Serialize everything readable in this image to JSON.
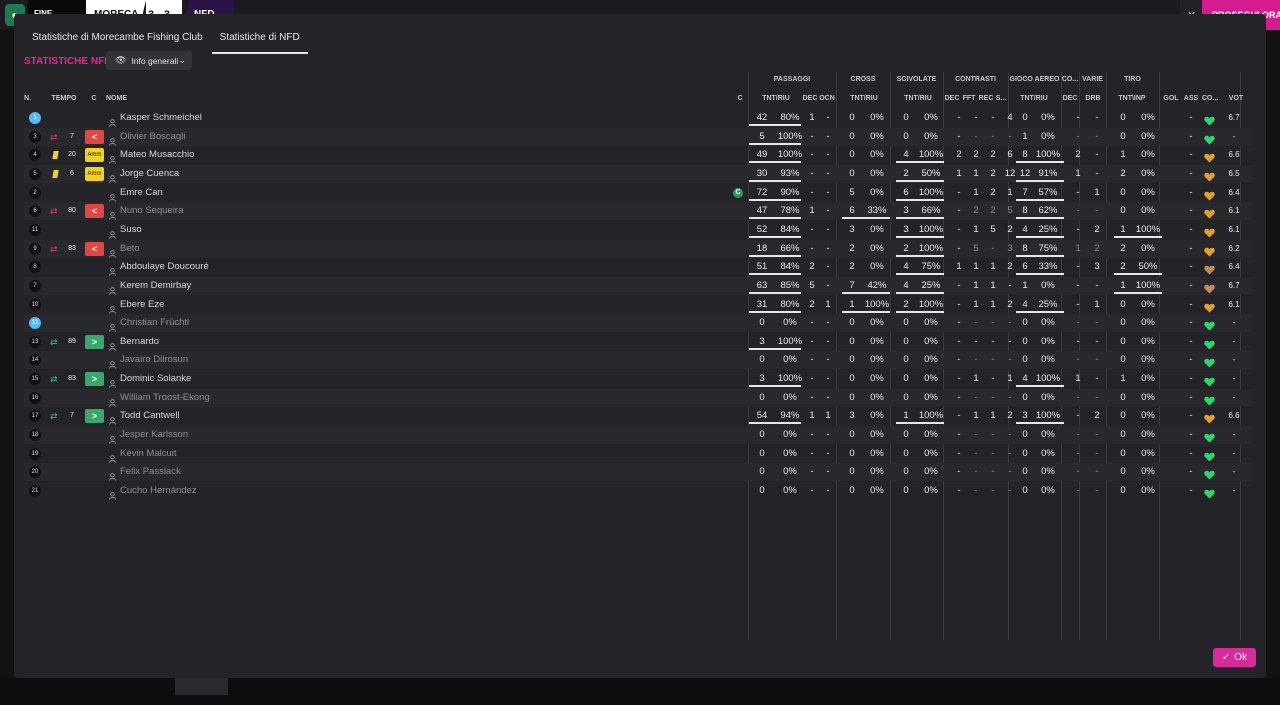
{
  "header": {
    "status": "FINE PARTITA",
    "team_home": "MORECA",
    "score": "3 - 3",
    "team_away": "NFD",
    "close_symbol": "✕",
    "continue_label": "PROSEGUI ORA"
  },
  "tabs": [
    {
      "label": "Statistiche di Morecambe Fishing Club",
      "active": false
    },
    {
      "label": "Statistiche di NFD",
      "active": true
    }
  ],
  "section_title": "STATISTICHE NFD",
  "view_select": {
    "value": "Info generali"
  },
  "groups": [
    "PASSAGGI",
    "CROSS",
    "SCIVOLATE",
    "CONTRASTI",
    "GIOCO AEREO",
    "CO...",
    "VARIE",
    "TIRO"
  ],
  "columns": {
    "n": "N.",
    "tempo": "TEMPO",
    "c": "C",
    "nome": "NOME",
    "c2": "C",
    "pass_tnt": "TNT/RIU",
    "pass_dec": "DEC",
    "pass_ocn": "OCN",
    "cross_tnt": "TNT/RIU",
    "sciv_tnt": "TNT/RIU",
    "con_dec": "DEC",
    "con_fft": "FFT",
    "con_rec": "REC",
    "con_s": "S...",
    "aereo_tnt": "TNT/RIU",
    "co_dec": "DEC",
    "varie_drb": "DRB",
    "tiro_tnt": "TNT\\INP",
    "gol": "GOL",
    "ass": "ASS",
    "co2": "CO...",
    "vot": "VOT"
  },
  "players": [
    {
      "num": "1",
      "gk": true,
      "tempo": "",
      "sub": "",
      "card": "",
      "badge": "",
      "name": "Kasper Schmeichel",
      "dim": false,
      "motm": false,
      "p1": "42",
      "p2": "80%",
      "dec": "1",
      "ocn": "-",
      "cr1": "0",
      "cr2": "0%",
      "sc1": "0",
      "sc2": "0%",
      "cdec": "-",
      "cfft": "-",
      "crec": "-",
      "cs": "4",
      "ga1": "0",
      "ga2": "0%",
      "codec": "-",
      "drb": "-",
      "t1": "0",
      "t2": "0%",
      "gol": "",
      "ass": "-",
      "heart": "green",
      "vot": "6.7",
      "ul_p": true,
      "ul_cr": false,
      "ul_sc": false,
      "ul_ga": false,
      "ul_t": false
    },
    {
      "num": "3",
      "gk": false,
      "tempo": "7",
      "sub": "out",
      "card": "",
      "badge": "red",
      "name": "Olivier Boscagli",
      "dim": true,
      "motm": false,
      "p1": "5",
      "p2": "100%",
      "dec": "-",
      "ocn": "-",
      "cr1": "0",
      "cr2": "0%",
      "sc1": "0",
      "sc2": "0%",
      "cdec": "-",
      "cfft": "-",
      "crec": "-",
      "cs": "-",
      "ga1": "1",
      "ga2": "0%",
      "codec": "-",
      "drb": "-",
      "t1": "0",
      "t2": "0%",
      "gol": "",
      "ass": "-",
      "heart": "green",
      "vot": "-",
      "ul_p": true,
      "ul_cr": false,
      "ul_sc": false,
      "ul_ga": false,
      "ul_t": false
    },
    {
      "num": "4",
      "gk": false,
      "tempo": "20",
      "sub": "",
      "card": "yellow",
      "badge": "amm",
      "name": "Mateo Musacchio",
      "dim": false,
      "motm": false,
      "p1": "49",
      "p2": "100%",
      "dec": "-",
      "ocn": "-",
      "cr1": "0",
      "cr2": "0%",
      "sc1": "4",
      "sc2": "100%",
      "cdec": "2",
      "cfft": "2",
      "crec": "2",
      "cs": "6",
      "ga1": "8",
      "ga2": "100%",
      "codec": "2",
      "drb": "-",
      "t1": "1",
      "t2": "0%",
      "gol": "",
      "ass": "-",
      "heart": "gold",
      "vot": "6.6",
      "ul_p": true,
      "ul_cr": false,
      "ul_sc": true,
      "ul_ga": true,
      "ul_t": false
    },
    {
      "num": "5",
      "gk": false,
      "tempo": "6",
      "sub": "",
      "card": "yellow",
      "badge": "amm",
      "name": "Jorge Cuenca",
      "dim": false,
      "motm": false,
      "p1": "30",
      "p2": "93%",
      "dec": "-",
      "ocn": "-",
      "cr1": "0",
      "cr2": "0%",
      "sc1": "2",
      "sc2": "50%",
      "cdec": "1",
      "cfft": "1",
      "crec": "2",
      "cs": "12",
      "ga1": "12",
      "ga2": "91%",
      "codec": "1",
      "drb": "-",
      "t1": "2",
      "t2": "0%",
      "gol": "",
      "ass": "-",
      "heart": "gold",
      "vot": "6.5",
      "ul_p": true,
      "ul_cr": false,
      "ul_sc": true,
      "ul_ga": true,
      "ul_t": false
    },
    {
      "num": "2",
      "gk": false,
      "tempo": "",
      "sub": "",
      "card": "",
      "badge": "",
      "name": "Emre Can",
      "dim": false,
      "motm": true,
      "p1": "72",
      "p2": "90%",
      "dec": "-",
      "ocn": "-",
      "cr1": "5",
      "cr2": "0%",
      "sc1": "6",
      "sc2": "100%",
      "cdec": "-",
      "cfft": "1",
      "crec": "2",
      "cs": "1",
      "ga1": "7",
      "ga2": "57%",
      "codec": "-",
      "drb": "1",
      "t1": "0",
      "t2": "0%",
      "gol": "",
      "ass": "-",
      "heart": "gold",
      "vot": "6.4",
      "ul_p": true,
      "ul_cr": false,
      "ul_sc": true,
      "ul_ga": true,
      "ul_t": false
    },
    {
      "num": "6",
      "gk": false,
      "tempo": "80",
      "sub": "out",
      "card": "",
      "badge": "red",
      "name": "Nuno Sequeira",
      "dim": true,
      "motm": false,
      "p1": "47",
      "p2": "78%",
      "dec": "1",
      "ocn": "-",
      "cr1": "6",
      "cr2": "33%",
      "sc1": "3",
      "sc2": "66%",
      "cdec": "-",
      "cfft": "2",
      "crec": "2",
      "cs": "5",
      "ga1": "8",
      "ga2": "62%",
      "codec": "-",
      "drb": "-",
      "t1": "0",
      "t2": "0%",
      "gol": "",
      "ass": "-",
      "heart": "gold",
      "vot": "6.1",
      "ul_p": true,
      "ul_cr": true,
      "ul_sc": true,
      "ul_ga": true,
      "ul_t": false
    },
    {
      "num": "11",
      "gk": false,
      "tempo": "",
      "sub": "",
      "card": "",
      "badge": "",
      "name": "Suso",
      "dim": false,
      "motm": false,
      "p1": "52",
      "p2": "84%",
      "dec": "-",
      "ocn": "-",
      "cr1": "3",
      "cr2": "0%",
      "sc1": "3",
      "sc2": "100%",
      "cdec": "-",
      "cfft": "1",
      "crec": "5",
      "cs": "2",
      "ga1": "4",
      "ga2": "25%",
      "codec": "-",
      "drb": "2",
      "t1": "1",
      "t2": "100%",
      "gol": "",
      "ass": "-",
      "heart": "gold",
      "vot": "6.1",
      "ul_p": true,
      "ul_cr": false,
      "ul_sc": true,
      "ul_ga": true,
      "ul_t": true
    },
    {
      "num": "9",
      "gk": false,
      "tempo": "83",
      "sub": "out",
      "card": "",
      "badge": "red",
      "name": "Beto",
      "dim": true,
      "motm": false,
      "p1": "18",
      "p2": "66%",
      "dec": "-",
      "ocn": "-",
      "cr1": "2",
      "cr2": "0%",
      "sc1": "2",
      "sc2": "100%",
      "cdec": "-",
      "cfft": "5",
      "crec": "-",
      "cs": "3",
      "ga1": "8",
      "ga2": "75%",
      "codec": "1",
      "drb": "2",
      "t1": "2",
      "t2": "0%",
      "gol": "",
      "ass": "-",
      "heart": "gold",
      "vot": "6.2",
      "ul_p": true,
      "ul_cr": false,
      "ul_sc": true,
      "ul_ga": true,
      "ul_t": false
    },
    {
      "num": "8",
      "gk": false,
      "tempo": "",
      "sub": "",
      "card": "",
      "badge": "",
      "name": "Abdoulaye Doucouré",
      "dim": false,
      "motm": false,
      "p1": "51",
      "p2": "84%",
      "dec": "2",
      "ocn": "-",
      "cr1": "2",
      "cr2": "0%",
      "sc1": "4",
      "sc2": "75%",
      "cdec": "1",
      "cfft": "1",
      "crec": "1",
      "cs": "2",
      "ga1": "6",
      "ga2": "33%",
      "codec": "-",
      "drb": "3",
      "t1": "2",
      "t2": "50%",
      "gol": "",
      "ass": "-",
      "heart": "bronze",
      "vot": "6.4",
      "ul_p": true,
      "ul_cr": false,
      "ul_sc": true,
      "ul_ga": true,
      "ul_t": true
    },
    {
      "num": "7",
      "gk": false,
      "tempo": "",
      "sub": "",
      "card": "",
      "badge": "",
      "name": "Kerem Demirbay",
      "dim": false,
      "motm": false,
      "p1": "63",
      "p2": "85%",
      "dec": "5",
      "ocn": "-",
      "cr1": "7",
      "cr2": "42%",
      "sc1": "4",
      "sc2": "25%",
      "cdec": "-",
      "cfft": "1",
      "crec": "1",
      "cs": "-",
      "ga1": "1",
      "ga2": "0%",
      "codec": "-",
      "drb": "-",
      "t1": "1",
      "t2": "100%",
      "gol": "",
      "ass": "-",
      "heart": "bronze",
      "vot": "6.7",
      "ul_p": true,
      "ul_cr": true,
      "ul_sc": true,
      "ul_ga": false,
      "ul_t": true
    },
    {
      "num": "10",
      "gk": false,
      "tempo": "",
      "sub": "",
      "card": "",
      "badge": "",
      "name": "Ebere Eze",
      "dim": false,
      "motm": false,
      "p1": "31",
      "p2": "80%",
      "dec": "2",
      "ocn": "1",
      "cr1": "1",
      "cr2": "100%",
      "sc1": "2",
      "sc2": "100%",
      "cdec": "-",
      "cfft": "1",
      "crec": "1",
      "cs": "2",
      "ga1": "4",
      "ga2": "25%",
      "codec": "-",
      "drb": "1",
      "t1": "0",
      "t2": "0%",
      "gol": "",
      "ass": "-",
      "heart": "gold",
      "vot": "6.1",
      "ul_p": true,
      "ul_cr": true,
      "ul_sc": true,
      "ul_ga": true,
      "ul_t": false
    },
    {
      "num": "12",
      "gk": true,
      "tempo": "",
      "sub": "",
      "card": "",
      "badge": "",
      "name": "Christian Früchtl",
      "dim": true,
      "motm": false,
      "p1": "0",
      "p2": "0%",
      "dec": "-",
      "ocn": "-",
      "cr1": "0",
      "cr2": "0%",
      "sc1": "0",
      "sc2": "0%",
      "cdec": "-",
      "cfft": "-",
      "crec": "-",
      "cs": "-",
      "ga1": "0",
      "ga2": "0%",
      "codec": "-",
      "drb": "-",
      "t1": "0",
      "t2": "0%",
      "gol": "",
      "ass": "-",
      "heart": "green",
      "vot": "-",
      "ul_p": false,
      "ul_cr": false,
      "ul_sc": false,
      "ul_ga": false,
      "ul_t": false
    },
    {
      "num": "13",
      "gk": false,
      "tempo": "89",
      "sub": "in",
      "card": "",
      "badge": "green",
      "name": "Bernardo",
      "dim": false,
      "motm": false,
      "p1": "3",
      "p2": "100%",
      "dec": "-",
      "ocn": "-",
      "cr1": "0",
      "cr2": "0%",
      "sc1": "0",
      "sc2": "0%",
      "cdec": "-",
      "cfft": "-",
      "crec": "-",
      "cs": "-",
      "ga1": "0",
      "ga2": "0%",
      "codec": "-",
      "drb": "-",
      "t1": "0",
      "t2": "0%",
      "gol": "",
      "ass": "-",
      "heart": "green",
      "vot": "-",
      "ul_p": true,
      "ul_cr": false,
      "ul_sc": false,
      "ul_ga": false,
      "ul_t": false
    },
    {
      "num": "14",
      "gk": false,
      "tempo": "",
      "sub": "",
      "card": "",
      "badge": "",
      "name": "Javairo Dilrosun",
      "dim": true,
      "motm": false,
      "p1": "0",
      "p2": "0%",
      "dec": "-",
      "ocn": "-",
      "cr1": "0",
      "cr2": "0%",
      "sc1": "0",
      "sc2": "0%",
      "cdec": "-",
      "cfft": "-",
      "crec": "-",
      "cs": "-",
      "ga1": "0",
      "ga2": "0%",
      "codec": "-",
      "drb": "-",
      "t1": "0",
      "t2": "0%",
      "gol": "",
      "ass": "-",
      "heart": "green",
      "vot": "-",
      "ul_p": false,
      "ul_cr": false,
      "ul_sc": false,
      "ul_ga": false,
      "ul_t": false
    },
    {
      "num": "15",
      "gk": false,
      "tempo": "83",
      "sub": "in",
      "card": "",
      "badge": "green",
      "name": "Dominic Solanke",
      "dim": false,
      "motm": false,
      "p1": "3",
      "p2": "100%",
      "dec": "-",
      "ocn": "-",
      "cr1": "0",
      "cr2": "0%",
      "sc1": "0",
      "sc2": "0%",
      "cdec": "-",
      "cfft": "1",
      "crec": "-",
      "cs": "1",
      "ga1": "4",
      "ga2": "100%",
      "codec": "1",
      "drb": "-",
      "t1": "1",
      "t2": "0%",
      "gol": "",
      "ass": "-",
      "heart": "green",
      "vot": "-",
      "ul_p": true,
      "ul_cr": false,
      "ul_sc": false,
      "ul_ga": true,
      "ul_t": false
    },
    {
      "num": "16",
      "gk": false,
      "tempo": "",
      "sub": "",
      "card": "",
      "badge": "",
      "name": "William Troost-Ekong",
      "dim": true,
      "motm": false,
      "p1": "0",
      "p2": "0%",
      "dec": "-",
      "ocn": "-",
      "cr1": "0",
      "cr2": "0%",
      "sc1": "0",
      "sc2": "0%",
      "cdec": "-",
      "cfft": "-",
      "crec": "-",
      "cs": "-",
      "ga1": "0",
      "ga2": "0%",
      "codec": "-",
      "drb": "-",
      "t1": "0",
      "t2": "0%",
      "gol": "",
      "ass": "-",
      "heart": "green",
      "vot": "-",
      "ul_p": false,
      "ul_cr": false,
      "ul_sc": false,
      "ul_ga": false,
      "ul_t": false
    },
    {
      "num": "17",
      "gk": false,
      "tempo": "7",
      "sub": "in",
      "card": "",
      "badge": "green",
      "name": "Todd Cantwell",
      "dim": false,
      "motm": false,
      "p1": "54",
      "p2": "94%",
      "dec": "1",
      "ocn": "1",
      "cr1": "3",
      "cr2": "0%",
      "sc1": "1",
      "sc2": "100%",
      "cdec": "-",
      "cfft": "1",
      "crec": "1",
      "cs": "2",
      "ga1": "3",
      "ga2": "100%",
      "codec": "-",
      "drb": "2",
      "t1": "0",
      "t2": "0%",
      "gol": "",
      "ass": "-",
      "heart": "gold",
      "vot": "6.6",
      "ul_p": true,
      "ul_cr": false,
      "ul_sc": true,
      "ul_ga": true,
      "ul_t": false
    },
    {
      "num": "18",
      "gk": false,
      "tempo": "",
      "sub": "",
      "card": "",
      "badge": "",
      "name": "Jesper Karlsson",
      "dim": true,
      "motm": false,
      "p1": "0",
      "p2": "0%",
      "dec": "-",
      "ocn": "-",
      "cr1": "0",
      "cr2": "0%",
      "sc1": "0",
      "sc2": "0%",
      "cdec": "-",
      "cfft": "-",
      "crec": "-",
      "cs": "-",
      "ga1": "0",
      "ga2": "0%",
      "codec": "-",
      "drb": "-",
      "t1": "0",
      "t2": "0%",
      "gol": "",
      "ass": "-",
      "heart": "green",
      "vot": "-",
      "ul_p": false,
      "ul_cr": false,
      "ul_sc": false,
      "ul_ga": false,
      "ul_t": false
    },
    {
      "num": "19",
      "gk": false,
      "tempo": "",
      "sub": "",
      "card": "",
      "badge": "",
      "name": "Kévin Malcuit",
      "dim": true,
      "motm": false,
      "p1": "0",
      "p2": "0%",
      "dec": "-",
      "ocn": "-",
      "cr1": "0",
      "cr2": "0%",
      "sc1": "0",
      "sc2": "0%",
      "cdec": "-",
      "cfft": "-",
      "crec": "-",
      "cs": "-",
      "ga1": "0",
      "ga2": "0%",
      "codec": "-",
      "drb": "-",
      "t1": "0",
      "t2": "0%",
      "gol": "",
      "ass": "-",
      "heart": "green",
      "vot": "-",
      "ul_p": false,
      "ul_cr": false,
      "ul_sc": false,
      "ul_ga": false,
      "ul_t": false
    },
    {
      "num": "20",
      "gk": false,
      "tempo": "",
      "sub": "",
      "card": "",
      "badge": "",
      "name": "Felix Passlack",
      "dim": true,
      "motm": false,
      "p1": "0",
      "p2": "0%",
      "dec": "-",
      "ocn": "-",
      "cr1": "0",
      "cr2": "0%",
      "sc1": "0",
      "sc2": "0%",
      "cdec": "-",
      "cfft": "-",
      "crec": "-",
      "cs": "-",
      "ga1": "0",
      "ga2": "0%",
      "codec": "-",
      "drb": "-",
      "t1": "0",
      "t2": "0%",
      "gol": "",
      "ass": "-",
      "heart": "green",
      "vot": "-",
      "ul_p": false,
      "ul_cr": false,
      "ul_sc": false,
      "ul_ga": false,
      "ul_t": false
    },
    {
      "num": "21",
      "gk": false,
      "tempo": "",
      "sub": "",
      "card": "",
      "badge": "",
      "name": "Cucho Hernández",
      "dim": true,
      "motm": false,
      "p1": "0",
      "p2": "0%",
      "dec": "-",
      "ocn": "-",
      "cr1": "0",
      "cr2": "0%",
      "sc1": "0",
      "sc2": "0%",
      "cdec": "-",
      "cfft": "-",
      "crec": "-",
      "cs": "-",
      "ga1": "0",
      "ga2": "0%",
      "codec": "-",
      "drb": "-",
      "t1": "0",
      "t2": "0%",
      "gol": "",
      "ass": "-",
      "heart": "green",
      "vot": "-",
      "ul_p": false,
      "ul_cr": false,
      "ul_sc": false,
      "ul_ga": false,
      "ul_t": false
    }
  ],
  "badge_labels": {
    "amm": "Amm",
    "out": "<",
    "in": ">"
  },
  "motm_letter": "C",
  "ok_button": {
    "label": "Ok",
    "check": "✓"
  },
  "colors": {
    "accent": "#d52b9b",
    "gk_badge": "#58b8f0",
    "card_red": "#e04646",
    "card_green": "#3aa86a",
    "yellow_card": "#f0d020",
    "heart_green": "#2fd46a",
    "heart_gold": "#e0a030",
    "heart_bronze": "#c08a5a"
  }
}
